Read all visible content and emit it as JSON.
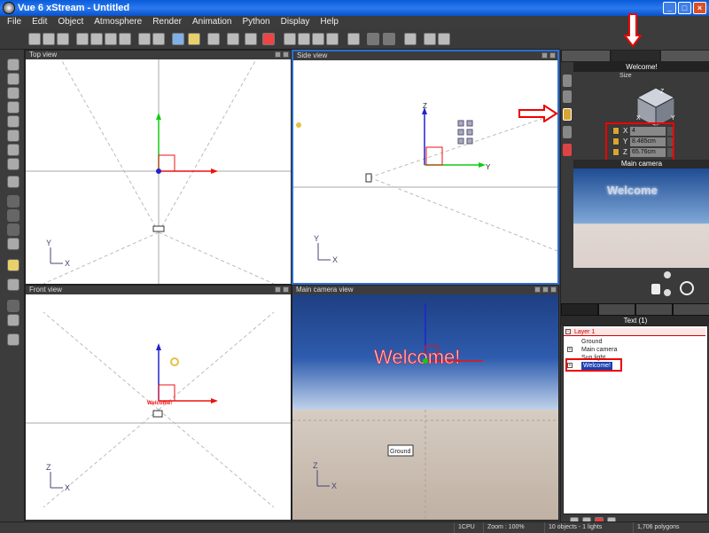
{
  "window": {
    "title": "Vue 6 xStream - Untitled",
    "buttons": [
      "_",
      "□",
      "×"
    ]
  },
  "menu": [
    "File",
    "Edit",
    "Object",
    "Atmosphere",
    "Render",
    "Animation",
    "Python",
    "Display",
    "Help"
  ],
  "viewports": {
    "top": {
      "title": "Top view",
      "axes": [
        "Y",
        "X"
      ]
    },
    "side": {
      "title": "Side view",
      "axes": [
        "Y",
        "X"
      ],
      "gizmo_labels": [
        "Z",
        "Y"
      ]
    },
    "front": {
      "title": "Front view",
      "axes": [
        "Z",
        "X"
      ],
      "object_label": "Welcome!"
    },
    "camera": {
      "title": "Main camera view",
      "text": "Welcome!",
      "ground_label": "Ground",
      "axes": [
        "Z",
        "X"
      ]
    }
  },
  "object_panel": {
    "title": "Welcome!",
    "size_label": "Size",
    "cube_labels": [
      "Z",
      "X",
      "Y"
    ],
    "dims": [
      {
        "axis": "X",
        "value": "4"
      },
      {
        "axis": "Y",
        "value": "8.485cm"
      },
      {
        "axis": "Z",
        "value": "65.76cm"
      }
    ]
  },
  "camera_preview": {
    "title": "Main camera",
    "text": "Welcome"
  },
  "world_browser": {
    "title": "Text (1)",
    "items": [
      {
        "label": "Layer 1",
        "kind": "layer"
      },
      {
        "label": "Ground",
        "kind": "item"
      },
      {
        "label": "Main camera",
        "kind": "item"
      },
      {
        "label": "Sun light",
        "kind": "item"
      },
      {
        "label": "Welcome!",
        "kind": "selected"
      }
    ]
  },
  "status": {
    "cpu": "1CPU",
    "zoom": "Zoom : 100%",
    "objects": "10 objects - 1 lights",
    "polygons": "1,706 polygons"
  },
  "colors": {
    "selection_red": "#e00000",
    "title_blue": "#0a5bd8",
    "sky_top": "#1e3f83",
    "ground": "#c8bcae"
  }
}
